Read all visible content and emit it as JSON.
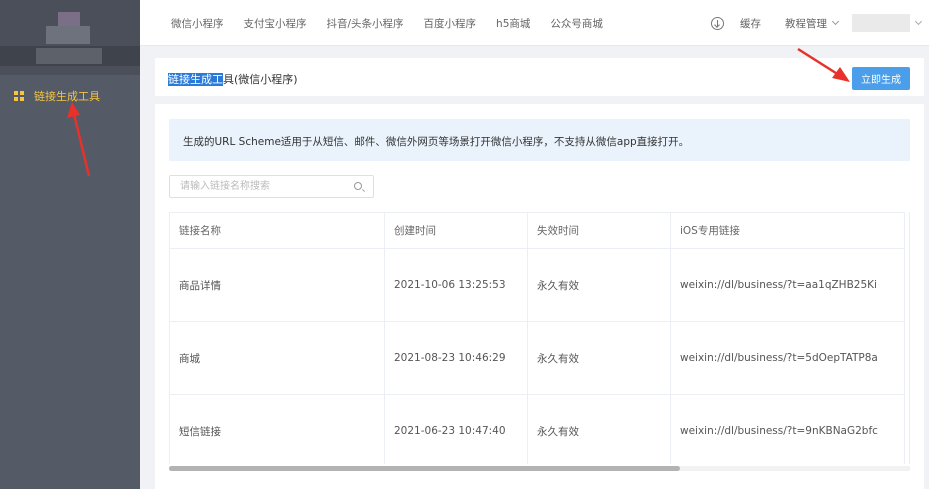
{
  "sidebar": {
    "items": [
      {
        "label": "链接生成工具",
        "icon": "grid-icon",
        "active": true
      }
    ],
    "active_color": "#f5c542"
  },
  "topnav": {
    "items": [
      "微信小程序",
      "支付宝小程序",
      "抖音/头条小程序",
      "百度小程序",
      "h5商城",
      "公众号商城"
    ]
  },
  "topright": {
    "download_icon": "download-icon",
    "cache_label": "缓存",
    "tutorial_label": "教程管理"
  },
  "title_panel": {
    "title_highlight": "链接生成工",
    "title_rest": "具(微信小程序)",
    "generate_button": "立即生成"
  },
  "notice": {
    "text": "生成的URL Scheme适用于从短信、邮件、微信外网页等场景打开微信小程序，不支持从微信app直接打开。"
  },
  "search": {
    "placeholder": "请输入链接名称搜索",
    "value": ""
  },
  "table": {
    "headers": [
      "链接名称",
      "创建时间",
      "失效时间",
      "iOS专用链接"
    ],
    "rows": [
      [
        "商品详情",
        "2021-10-06 13:25:53",
        "永久有效",
        "weixin://dl/business/?t=aa1qZHB25Ki"
      ],
      [
        "商城",
        "2021-08-23 10:46:29",
        "永久有效",
        "weixin://dl/business/?t=5dOepTATP8a"
      ],
      [
        "短信链接",
        "2021-06-23 10:47:40",
        "永久有效",
        "weixin://dl/business/?t=9nKBNaG2bfc"
      ]
    ]
  },
  "colors": {
    "accent": "#4a9eea",
    "sidebar_bg": "#545a66",
    "annotation_arrow": "#e8312a"
  }
}
